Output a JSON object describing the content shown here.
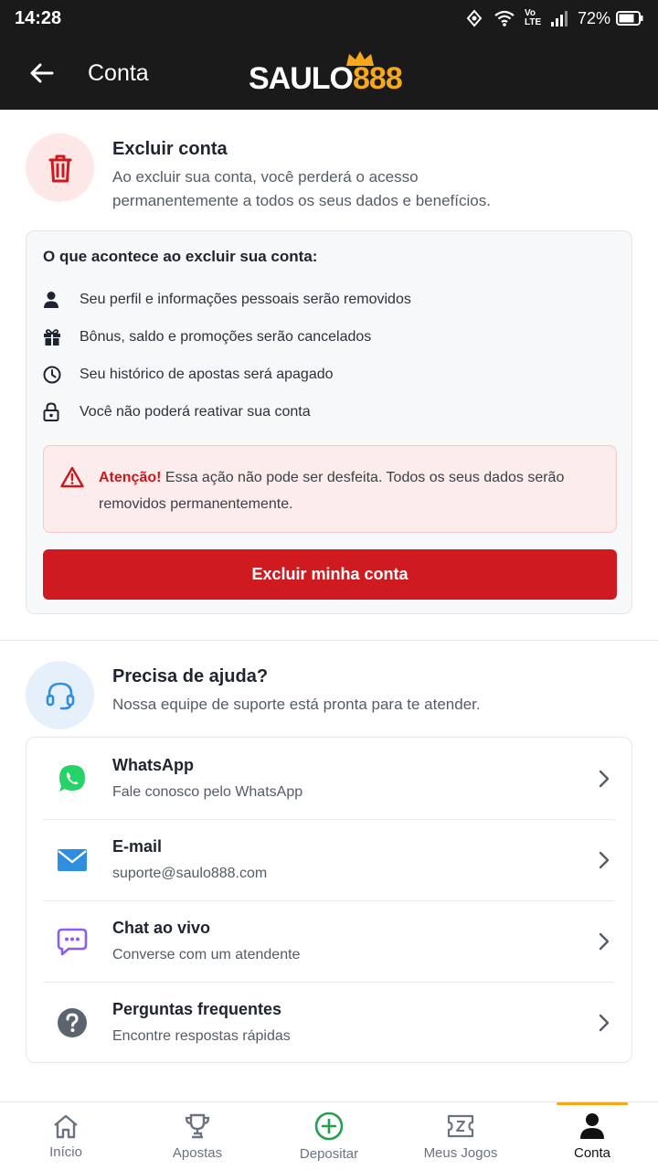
{
  "status_bar": {
    "time": "14:28",
    "network": "Vo LTE",
    "battery": "72%"
  },
  "header": {
    "title": "Conta",
    "logo_text_a": "SAULO",
    "logo_text_b": "888"
  },
  "delete_section": {
    "title": "Excluir conta",
    "description": "Ao excluir sua conta, você perderá o acesso permanentemente a todos os seus dados e benefícios.",
    "card_title": "O que acontece ao excluir sua conta:",
    "items": [
      {
        "icon": "user-icon",
        "label": "Seu perfil e informações pessoais serão removidos"
      },
      {
        "icon": "gift-icon",
        "label": "Bônus, saldo e promoções serão cancelados"
      },
      {
        "icon": "clock-icon",
        "label": "Seu histórico de apostas será apagado"
      },
      {
        "icon": "lock-icon",
        "label": "Você não poderá reativar sua conta"
      }
    ],
    "warning_strong": "Atenção!",
    "warning_text": " Essa ação não pode ser desfeita. Todos os seus dados serão removidos permanentemente.",
    "button_label": "Excluir minha conta"
  },
  "help_section": {
    "title": "Precisa de ajuda?",
    "description": "Nossa equipe de suporte está pronta para te atender.",
    "items": [
      {
        "icon": "whatsapp-icon",
        "title": "WhatsApp",
        "subtitle": "Fale conosco pelo WhatsApp"
      },
      {
        "icon": "mail-icon",
        "title": "E-mail",
        "subtitle": "suporte@saulo888.com"
      },
      {
        "icon": "chat-icon",
        "title": "Chat ao vivo",
        "subtitle": "Converse com um atendente"
      },
      {
        "icon": "question-icon",
        "title": "Perguntas frequentes",
        "subtitle": "Encontre respostas rápidas"
      }
    ]
  },
  "bottom_nav": {
    "items": [
      {
        "label": "Início",
        "icon": "home-icon"
      },
      {
        "label": "Apostas",
        "icon": "trophy-icon"
      },
      {
        "label": "Depositar",
        "icon": "plus-circle-icon"
      },
      {
        "label": "Meus Jogos",
        "icon": "ticket-icon"
      },
      {
        "label": "Conta",
        "icon": "person-icon",
        "active": true
      }
    ]
  },
  "colors": {
    "brand": "#f6a81a",
    "danger": "#cf1b1f",
    "header_bg": "#1a1a1a",
    "whatsapp": "#25d366",
    "mail": "#2f8ee0",
    "chat": "#8b5cf6"
  }
}
